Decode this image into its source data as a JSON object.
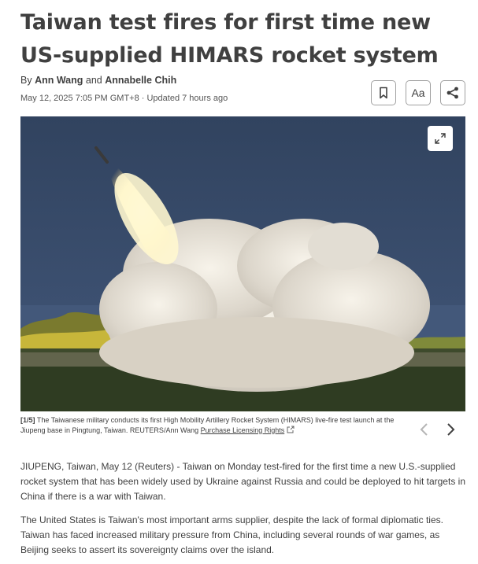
{
  "article": {
    "headline": "Taiwan test fires for first time new US-supplied HIMARS rocket system",
    "byline": {
      "prefix": "By",
      "author1": "Ann Wang",
      "joiner": "and",
      "author2": "Annabelle Chih"
    },
    "dateline": "May 12, 2025 7:05 PM GMT+8 · Updated 7 hours ago",
    "toolbar": {
      "text_size_label": "Aa"
    },
    "gallery": {
      "counter": "[1/5]",
      "caption": "The Taiwanese military conducts its first High Mobility Artillery Rocket System (HIMARS) live-fire test launch at the Jiupeng base in Pingtung, Taiwan. REUTERS/Ann Wang",
      "license_link": "Purchase Licensing Rights"
    },
    "paragraphs": [
      "JIUPENG, Taiwan, May 12 (Reuters) - Taiwan on Monday test-fired for the first time a new U.S.-supplied rocket system that has been widely used by Ukraine against Russia and could be deployed to hit targets in China if there is a war with Taiwan.",
      "The United States is Taiwan's most important arms supplier, despite the lack of formal diplomatic ties. Taiwan has faced increased military pressure from China, including several rounds of war games, as Beijing seeks to assert its sovereignty claims over the island."
    ]
  },
  "icons": [
    "bookmark-icon",
    "share-icon",
    "expand-icon",
    "external-link-icon",
    "chevron-left-icon",
    "chevron-right-icon"
  ],
  "colors": {
    "text": "#404040",
    "sea": "#3a4d68",
    "smoke": "#e8e4dc",
    "flame": "#fff2b0"
  }
}
